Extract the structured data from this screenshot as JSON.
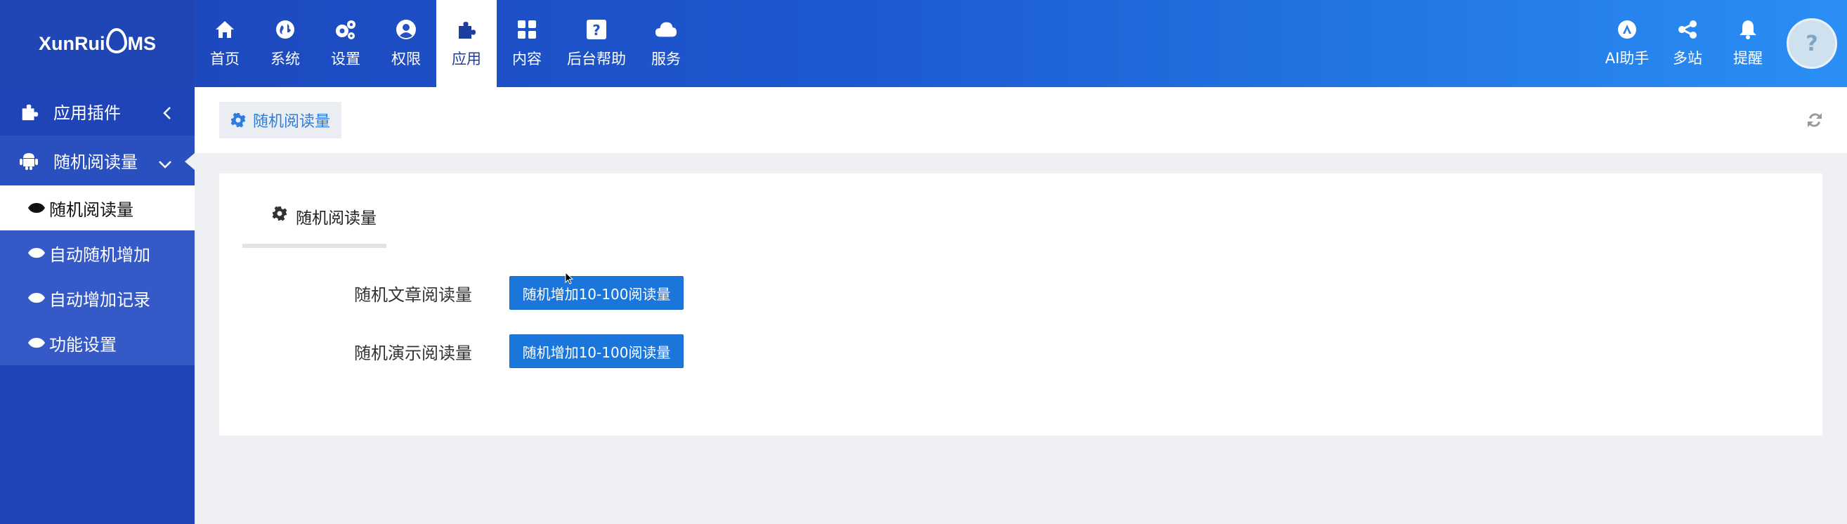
{
  "logo": {
    "part1": "XunRui",
    "part2": "MS"
  },
  "nav": [
    {
      "label": "首页",
      "icon": "home-icon"
    },
    {
      "label": "系统",
      "icon": "globe-icon"
    },
    {
      "label": "设置",
      "icon": "gears-icon"
    },
    {
      "label": "权限",
      "icon": "user-circle-icon"
    },
    {
      "label": "应用",
      "icon": "puzzle-icon",
      "active": true
    },
    {
      "label": "内容",
      "icon": "grid-icon"
    },
    {
      "label": "后台帮助",
      "icon": "question-icon"
    },
    {
      "label": "服务",
      "icon": "cloud-icon"
    }
  ],
  "right_nav": [
    {
      "label": "AI助手",
      "icon": "ai-icon"
    },
    {
      "label": "多站",
      "icon": "share-icon"
    },
    {
      "label": "提醒",
      "icon": "bell-icon"
    }
  ],
  "avatar": {
    "glyph": "?"
  },
  "sidebar": {
    "groups": [
      {
        "label": "应用插件",
        "icon": "puzzle-icon",
        "chevron": "chevron-left-icon"
      },
      {
        "label": "随机阅读量",
        "icon": "android-icon",
        "chevron": "chevron-down-icon",
        "open": true
      }
    ],
    "items": [
      {
        "label": "随机阅读量",
        "icon": "eye-icon",
        "active": true
      },
      {
        "label": "自动随机增加",
        "icon": "eye-icon"
      },
      {
        "label": "自动增加记录",
        "icon": "eye-icon"
      },
      {
        "label": "功能设置",
        "icon": "eye-icon"
      }
    ]
  },
  "breadcrumb": {
    "label": "随机阅读量",
    "icon": "gear-icon"
  },
  "panel": {
    "tab_label": "随机阅读量",
    "rows": [
      {
        "label": "随机文章阅读量",
        "button": "随机增加10-100阅读量"
      },
      {
        "label": "随机演示阅读量",
        "button": "随机增加10-100阅读量"
      }
    ]
  },
  "colors": {
    "brand": "#1f44b8",
    "accent": "#1b76dc",
    "link": "#2b7de0"
  }
}
